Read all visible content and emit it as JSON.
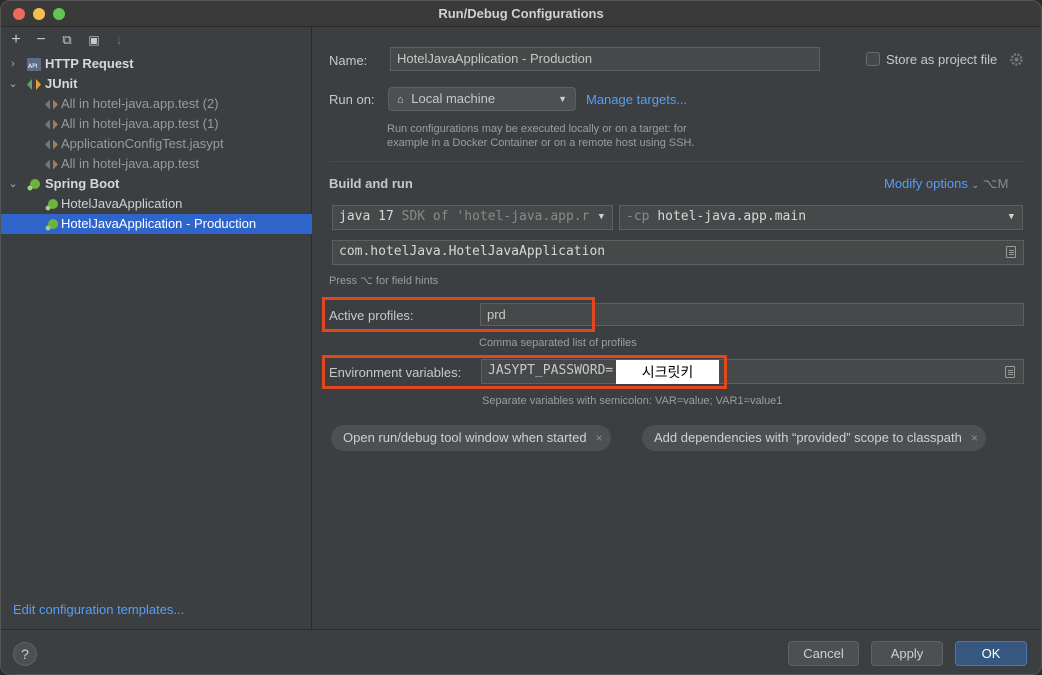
{
  "window": {
    "title": "Run/Debug Configurations"
  },
  "toolbar": {
    "add": "+",
    "remove": "−",
    "copy": "⧉",
    "folder": "▣",
    "sort": "↓"
  },
  "tree": {
    "items": [
      {
        "label": "HTTP Request",
        "level": 0,
        "expanded": false,
        "bold": true,
        "icon": "api-icon"
      },
      {
        "label": "JUnit",
        "level": 0,
        "expanded": true,
        "bold": true,
        "icon": "junit-icon"
      },
      {
        "label": "All in hotel-java.app.test (2)",
        "level": 1,
        "icon": "test-icon"
      },
      {
        "label": "All in hotel-java.app.test (1)",
        "level": 1,
        "icon": "test-icon"
      },
      {
        "label": "ApplicationConfigTest.jasypt",
        "level": 1,
        "icon": "test-icon"
      },
      {
        "label": "All in hotel-java.app.test",
        "level": 1,
        "icon": "test-icon"
      },
      {
        "label": "Spring Boot",
        "level": 0,
        "expanded": true,
        "bold": true,
        "icon": "spring-boot-icon"
      },
      {
        "label": "HotelJavaApplication",
        "level": 1,
        "icon": "spring-boot-icon"
      },
      {
        "label": "HotelJavaApplication - Production",
        "level": 1,
        "icon": "spring-boot-icon",
        "selected": true
      }
    ]
  },
  "edit_templates": "Edit configuration templates...",
  "form": {
    "name_label": "Name:",
    "name_value": "HotelJavaApplication - Production",
    "store_label": "Store as project file",
    "run_on_label": "Run on:",
    "run_on_value": "Local machine",
    "manage_targets": "Manage targets...",
    "run_on_hint_1": "Run configurations may be executed locally or on a target: for",
    "run_on_hint_2": "example in a Docker Container or on a remote host using SSH.",
    "build_and_run": "Build and run",
    "modify_options": "Modify options",
    "modify_shortcut": "⌥M",
    "jdk_main": "java 17",
    "jdk_sdk": "SDK of 'hotel-java.app.r",
    "cp_flag": "-cp",
    "cp_value": "hotel-java.app.main",
    "main_class": "com.hotelJava.HotelJavaApplication",
    "field_hint": "Press ⌥ for field hints",
    "active_profiles_label": "Active profiles:",
    "active_profiles_value": "prd",
    "profiles_hint": "Comma separated list of profiles",
    "env_label": "Environment variables:",
    "env_value": "JASYPT_PASSWORD=",
    "env_secret": "시크릿키",
    "env_hint": "Separate variables with semicolon: VAR=value; VAR1=value1",
    "chip_1": "Open run/debug tool window when started",
    "chip_2": "Add dependencies with “provided” scope to classpath",
    "chip_close": "×"
  },
  "buttons": {
    "help": "?",
    "cancel": "Cancel",
    "apply": "Apply",
    "ok": "OK"
  },
  "colors": {
    "accent": "#2f65ca",
    "link": "#589df6",
    "highlight": "#e2461f",
    "ok_button": "#365880"
  }
}
